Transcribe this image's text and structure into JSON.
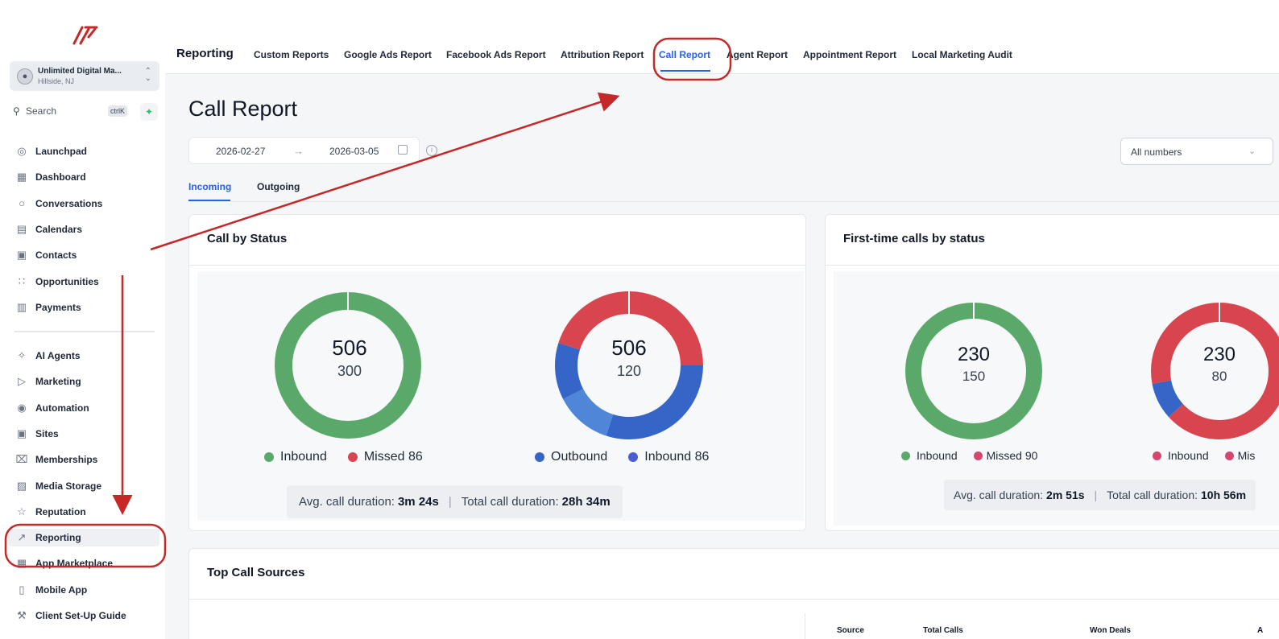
{
  "sidebar": {
    "account": {
      "name": "Unlimited Digital Ma...",
      "location": "Hillside, NJ"
    },
    "search": {
      "placeholder": "Search",
      "shortcut": "ctrlK"
    },
    "items_top": [
      {
        "label": "Launchpad",
        "icon": "launchpad-icon"
      },
      {
        "label": "Dashboard",
        "icon": "dashboard-icon"
      },
      {
        "label": "Conversations",
        "icon": "chat-icon"
      },
      {
        "label": "Calendars",
        "icon": "calendar-icon"
      },
      {
        "label": "Contacts",
        "icon": "contacts-icon"
      },
      {
        "label": "Opportunities",
        "icon": "opportunities-icon"
      },
      {
        "label": "Payments",
        "icon": "payments-icon"
      }
    ],
    "items_bottom": [
      {
        "label": "AI Agents",
        "icon": "sparkle-icon"
      },
      {
        "label": "Marketing",
        "icon": "send-icon"
      },
      {
        "label": "Automation",
        "icon": "automation-icon"
      },
      {
        "label": "Sites",
        "icon": "sites-icon"
      },
      {
        "label": "Memberships",
        "icon": "membership-icon"
      },
      {
        "label": "Media Storage",
        "icon": "image-icon"
      },
      {
        "label": "Reputation",
        "icon": "star-icon"
      },
      {
        "label": "Reporting",
        "icon": "trend-icon"
      },
      {
        "label": "App Marketplace",
        "icon": "apps-icon"
      },
      {
        "label": "Mobile App",
        "icon": "mobile-icon"
      },
      {
        "label": "Client Set-Up Guide",
        "icon": "wrench-icon"
      }
    ]
  },
  "topnav": {
    "title": "Reporting",
    "tabs": [
      {
        "label": "Custom Reports"
      },
      {
        "label": "Google Ads Report"
      },
      {
        "label": "Facebook Ads Report"
      },
      {
        "label": "Attribution Report"
      },
      {
        "label": "Call Report",
        "active": true
      },
      {
        "label": "Agent Report"
      },
      {
        "label": "Appointment Report"
      },
      {
        "label": "Local Marketing Audit"
      }
    ]
  },
  "page": {
    "title": "Call Report",
    "date_start": "2026-02-27",
    "date_end": "2026-03-05",
    "numbers_select": "All numbers",
    "subtabs": [
      "Incoming",
      "Outgoing"
    ]
  },
  "colors": {
    "green": "#5aa96a",
    "red": "#d9454f",
    "blue": "#3566c7",
    "light_blue": "#4f86d8",
    "accent": "#2563eb"
  },
  "cards": {
    "call_by_status": {
      "title": "Call by Status",
      "donut1": {
        "total": "506",
        "sub": "300",
        "legend": [
          "Inbound",
          "Missed 86"
        ]
      },
      "donut2": {
        "total": "506",
        "sub": "120",
        "legend": [
          "Outbound",
          "Inbound 86"
        ]
      },
      "stats": {
        "avg_label": "Avg. call duration:",
        "avg_value": "3m 24s",
        "total_label": "Total call duration:",
        "total_value": "28h 34m"
      }
    },
    "first_time": {
      "title": "First-time calls by status",
      "donut1": {
        "total": "230",
        "sub": "150",
        "legend": [
          "Inbound",
          "Missed 90"
        ]
      },
      "donut2": {
        "total": "230",
        "sub": "80",
        "legend": [
          "Inbound",
          "Mis"
        ]
      },
      "stats": {
        "avg_label": "Avg. call duration:",
        "avg_value": "2m 51s",
        "total_label": "Total call duration:",
        "total_value": "10h 56m"
      }
    },
    "top_sources": {
      "title": "Top Call Sources",
      "columns": [
        "Source",
        "Total Calls",
        "Won Deals",
        "A"
      ]
    }
  }
}
